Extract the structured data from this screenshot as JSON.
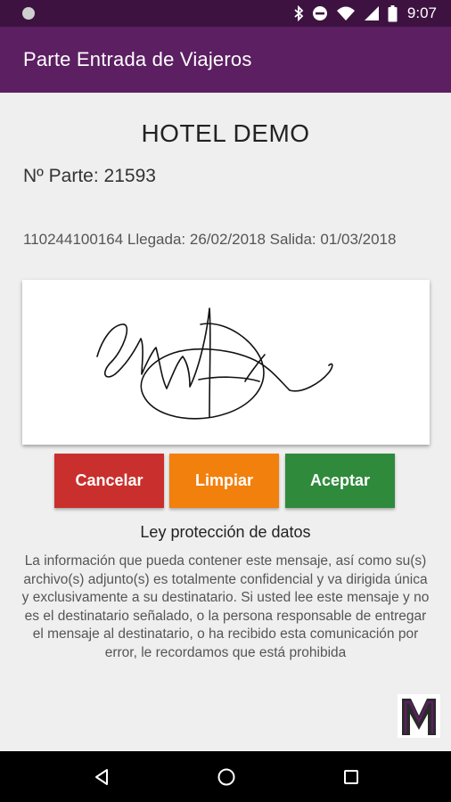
{
  "status_bar": {
    "time": "9:07",
    "icons": [
      "notification-dot-icon",
      "bluetooth-icon",
      "do-not-disturb-icon",
      "wifi-icon",
      "signal-icon",
      "battery-icon"
    ]
  },
  "app_bar": {
    "title": "Parte Entrada de Viajeros",
    "color": "#5c1f62"
  },
  "hotel": {
    "name": "HOTEL DEMO"
  },
  "parte": {
    "label": "Nº Parte: 21593"
  },
  "stay": {
    "info": "110244100164 Llegada: 26/02/2018 Salida: 01/03/2018"
  },
  "signature": {
    "stroke_color": "#111111"
  },
  "buttons": {
    "cancel": {
      "label": "Cancelar",
      "color": "#c92f2c"
    },
    "clear": {
      "label": "Limpiar",
      "color": "#f2800d"
    },
    "accept": {
      "label": "Aceptar",
      "color": "#2f8a3c"
    }
  },
  "privacy": {
    "title": "Ley protección de datos",
    "text": "La información que pueda contener este mensaje, así como su(s) archivo(s) adjunto(s) es totalmente confidencial y va dirigida única y exclusivamente a su destinatario. Si usted lee este mensaje y no es el destinatario señalado, o la persona responsable de entregar el mensaje al destinatario, o ha recibido esta comunicación por error, le recordamos que está prohibida"
  },
  "logo": {
    "icon": "m-logo-icon"
  },
  "nav_bar": {
    "icons": [
      "back-icon",
      "home-icon",
      "recents-icon"
    ]
  }
}
